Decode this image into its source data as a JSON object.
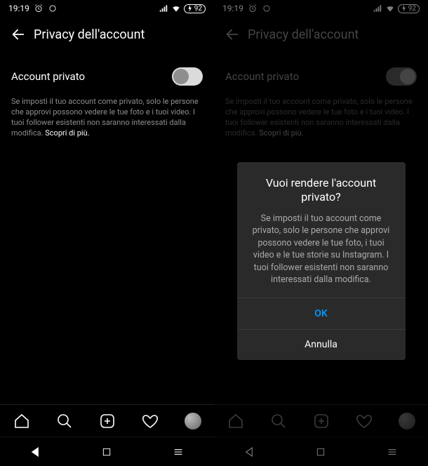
{
  "status": {
    "time": "19:19",
    "battery": "92"
  },
  "header": {
    "title": "Privacy dell'account"
  },
  "privacy": {
    "toggle_label": "Account privato",
    "description_prefix": "Se imposti il tuo account come privato, solo le persone che approvi possono vedere le tue foto e i tuoi video. I tuoi follower esistenti non saranno interessati dalla modifica. ",
    "learn_more": "Scopri di più."
  },
  "dialog": {
    "title": "Vuoi rendere l'account privato?",
    "body": "Se imposti il tuo account come privato, solo le persone che approvi possono vedere le tue foto, i tuoi video e le tue storie su Instagram. I tuoi follower esistenti non saranno interessati dalla modifica.",
    "ok": "OK",
    "cancel": "Annulla"
  },
  "icons": {
    "alarm": "alarm-icon",
    "signal": "signal-icon",
    "wifi": "wifi-icon"
  }
}
